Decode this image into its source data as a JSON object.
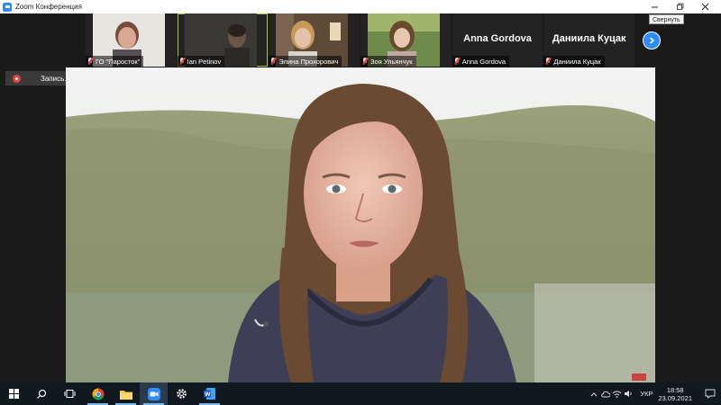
{
  "window": {
    "title": "Zoom Конференция",
    "tooltip": "Свернуть"
  },
  "participants": [
    {
      "name": "ГО \"Паросток\"",
      "has_video": true,
      "muted": true,
      "active": false
    },
    {
      "name": "Ian Petinov",
      "has_video": true,
      "muted": true,
      "active": true
    },
    {
      "name": "Элина Прохорович",
      "has_video": true,
      "muted": true,
      "active": false
    },
    {
      "name": "Зоя Ульянчук",
      "has_video": true,
      "muted": true,
      "active": false
    },
    {
      "name": "Anna Gordova",
      "display_name": "Anna Gordova",
      "has_video": false,
      "muted": true,
      "active": false
    },
    {
      "name": "Даниила Куцак",
      "display_name": "Даниила Куцак",
      "has_video": false,
      "muted": true,
      "active": false
    }
  ],
  "recording": {
    "label": "Запись..."
  },
  "taskbar": {
    "apps": [
      "windows-start",
      "search",
      "task-view",
      "chrome",
      "file-explorer",
      "zoom",
      "settings",
      "word"
    ],
    "language": "УКР",
    "time": "18:58",
    "date": "23.09.2021"
  },
  "colors": {
    "accent": "#2d8cff",
    "active_speaker": "#9bcb30",
    "muted": "#e03b3b",
    "taskbar": "#101820"
  }
}
